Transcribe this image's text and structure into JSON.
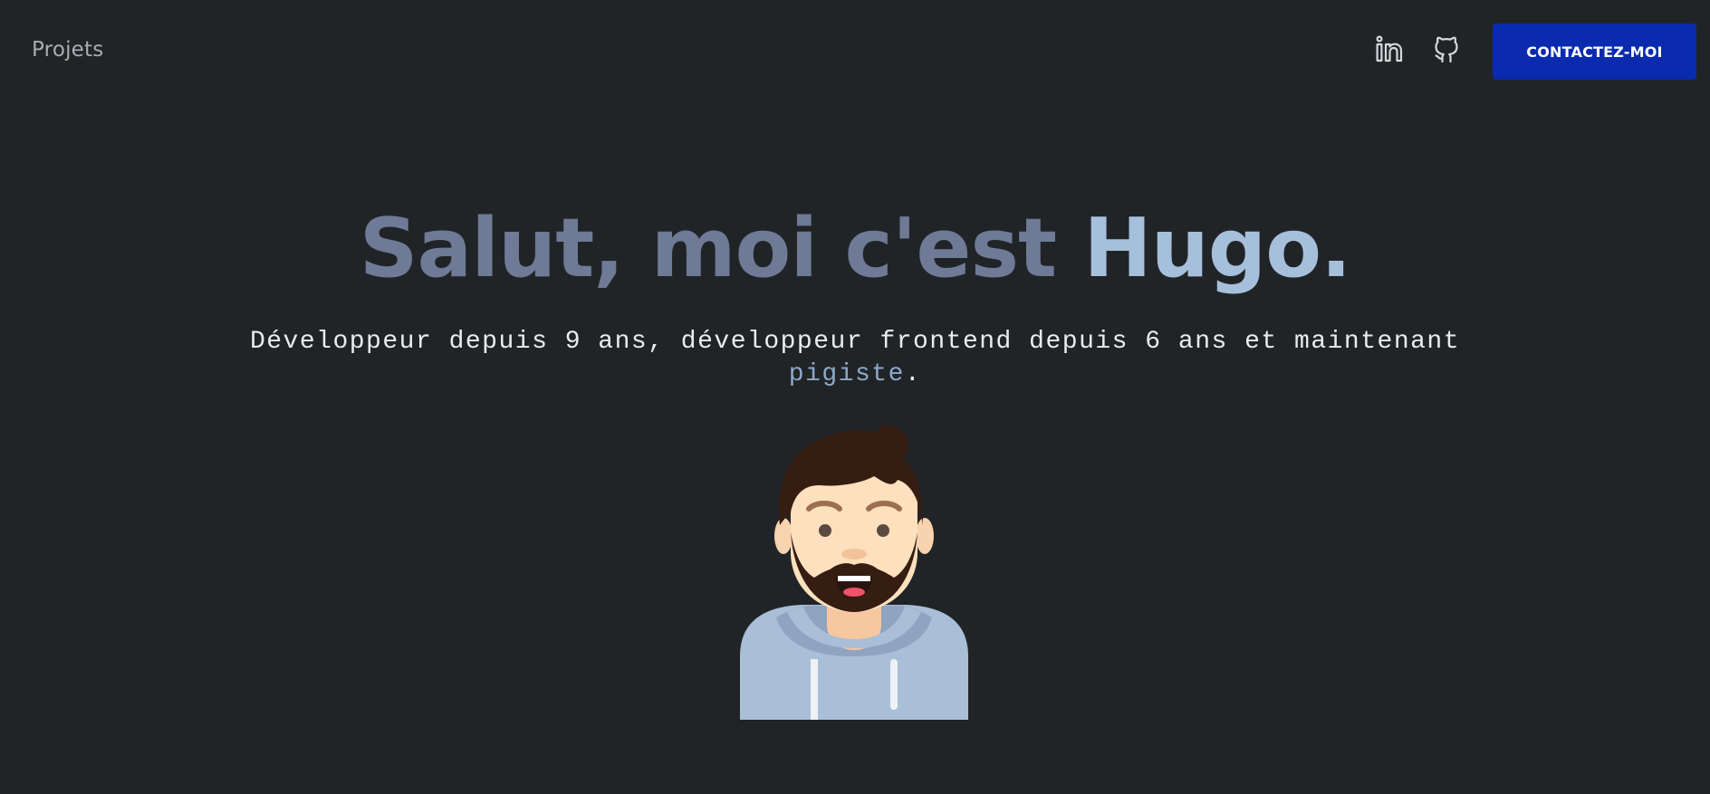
{
  "nav": {
    "projects_label": "Projets"
  },
  "social": {
    "linkedin_icon": "linkedin-icon",
    "github_icon": "github-icon"
  },
  "cta": {
    "label": "CONTACTEZ-MOI",
    "color": "#0a2bae"
  },
  "hero": {
    "title_prefix": "Salut, moi c'est ",
    "title_name": "Hugo",
    "title_suffix": ".",
    "subtitle_main": "Développeur depuis 9 ans, développeur frontend depuis 6 ans et maintenant ",
    "subtitle_highlight": "pigiste",
    "subtitle_end": "."
  },
  "colors": {
    "background": "#212427",
    "title": "#6e7a96",
    "name": "#a6bfdb",
    "highlight": "#8ea8c8"
  },
  "avatar": {
    "icon": "bearded-man-avatar-icon"
  }
}
